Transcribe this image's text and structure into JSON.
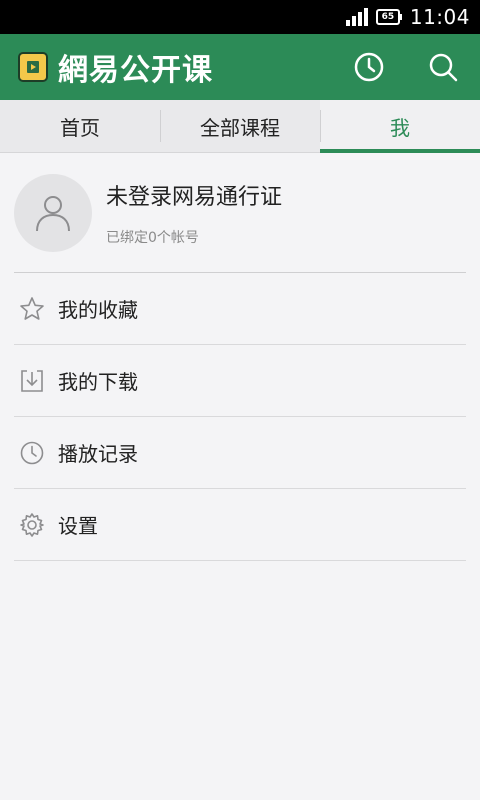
{
  "status_bar": {
    "battery": "65",
    "time": "11:04"
  },
  "app_bar": {
    "title": "網易公开课",
    "actions": [
      {
        "icon": "clock-icon"
      },
      {
        "icon": "search-icon"
      }
    ]
  },
  "tabs": [
    {
      "label": "首页",
      "active": false
    },
    {
      "label": "全部课程",
      "active": false
    },
    {
      "label": "我",
      "active": true
    }
  ],
  "profile": {
    "name": "未登录网易通行证",
    "subtitle": "已绑定0个帐号"
  },
  "menu": [
    {
      "label": "我的收藏",
      "icon": "star-icon"
    },
    {
      "label": "我的下载",
      "icon": "download-icon"
    },
    {
      "label": "播放记录",
      "icon": "history-clock-icon"
    },
    {
      "label": "设置",
      "icon": "gear-icon"
    }
  ],
  "colors": {
    "accent": "#2c8b57",
    "status_bar": "#000000",
    "background": "#f4f4f6"
  }
}
